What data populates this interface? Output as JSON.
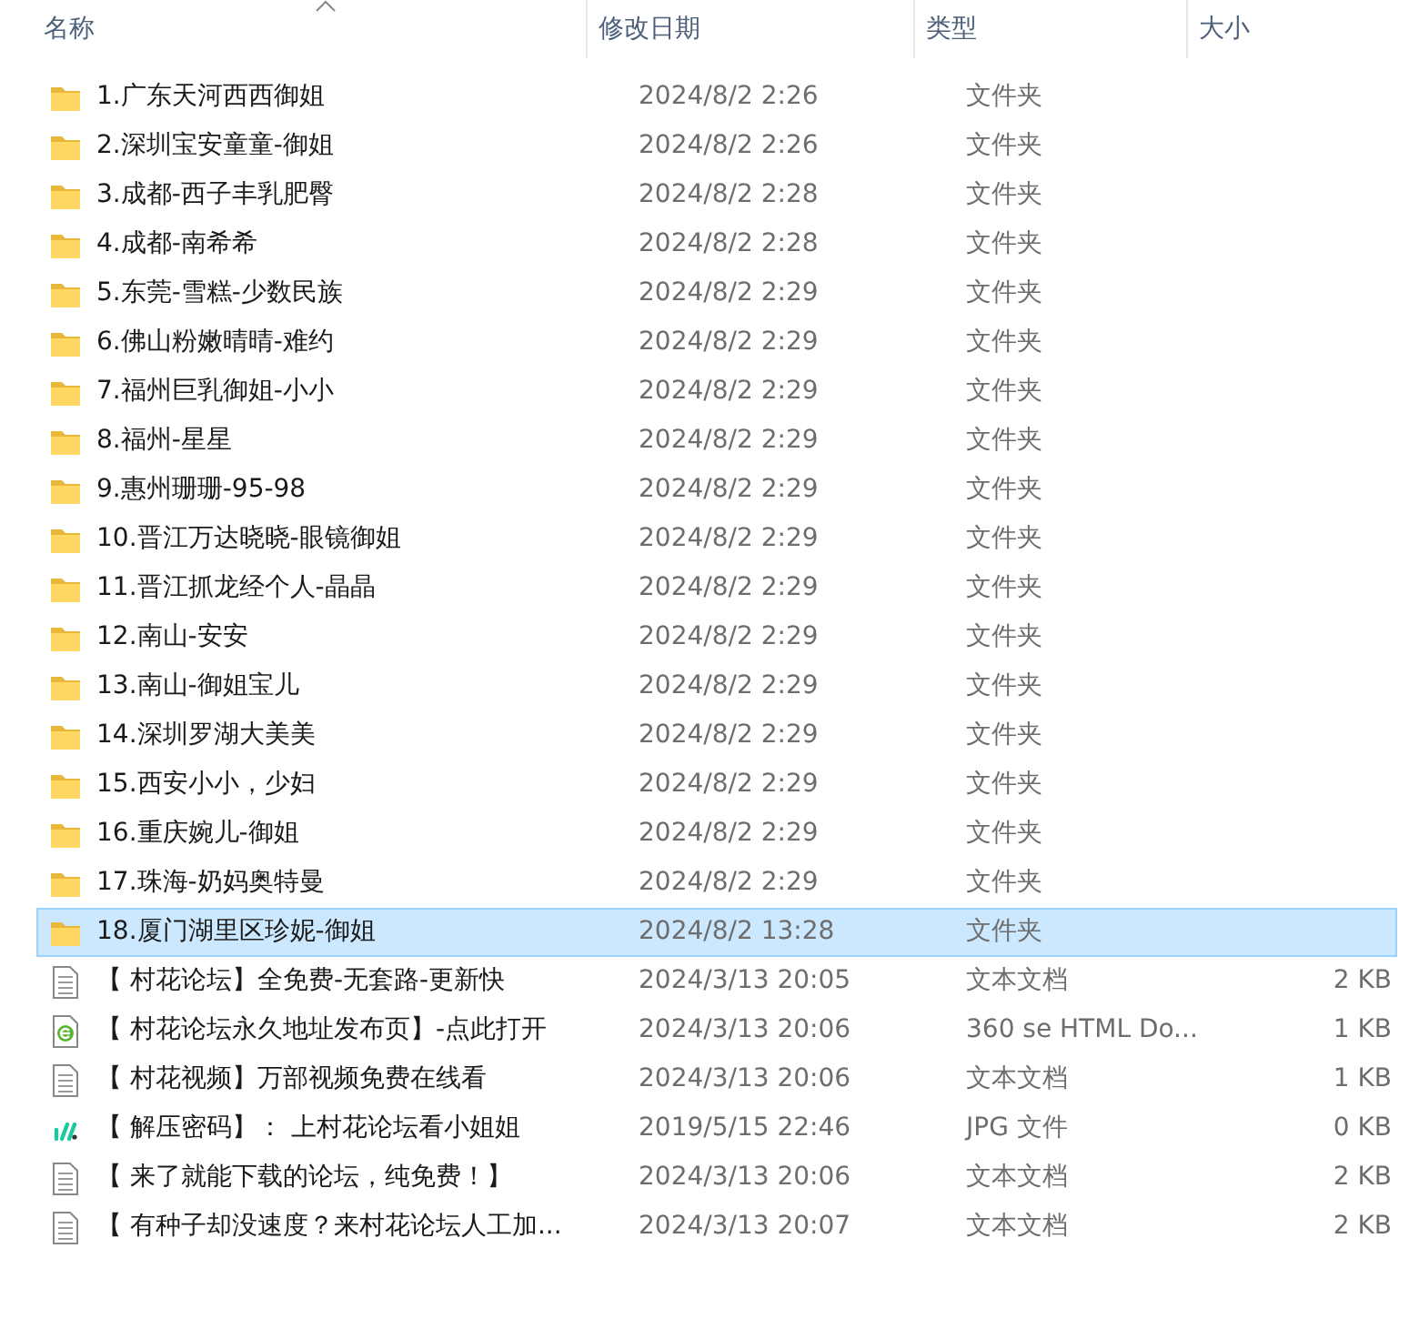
{
  "columns": [
    {
      "label": "名称",
      "sorted": true
    },
    {
      "label": "修改日期",
      "sorted": false
    },
    {
      "label": "类型",
      "sorted": false
    },
    {
      "label": "大小",
      "sorted": false
    }
  ],
  "files": [
    {
      "kind": "folder",
      "name": "1.广东天河西西御姐",
      "date": "2024/8/2 2:26",
      "type": "文件夹",
      "selected": false
    },
    {
      "kind": "folder",
      "name": "2.深圳宝安童童-御姐",
      "date": "2024/8/2 2:26",
      "type": "文件夹",
      "selected": false
    },
    {
      "kind": "folder",
      "name": "3.成都-西子丰乳肥臀",
      "date": "2024/8/2 2:28",
      "type": "文件夹",
      "selected": false
    },
    {
      "kind": "folder",
      "name": "4.成都-南希希",
      "date": "2024/8/2 2:28",
      "type": "文件夹",
      "selected": false
    },
    {
      "kind": "folder",
      "name": "5.东莞-雪糕-少数民族",
      "date": "2024/8/2 2:29",
      "type": "文件夹",
      "selected": false
    },
    {
      "kind": "folder",
      "name": "6.佛山粉嫩晴晴-难约",
      "date": "2024/8/2 2:29",
      "type": "文件夹",
      "selected": false
    },
    {
      "kind": "folder",
      "name": "7.福州巨乳御姐-小小",
      "date": "2024/8/2 2:29",
      "type": "文件夹",
      "selected": false
    },
    {
      "kind": "folder",
      "name": "8.福州-星星",
      "date": "2024/8/2 2:29",
      "type": "文件夹",
      "selected": false
    },
    {
      "kind": "folder",
      "name": "9.惠州珊珊-95-98",
      "date": "2024/8/2 2:29",
      "type": "文件夹",
      "selected": false
    },
    {
      "kind": "folder",
      "name": "10.晋江万达晓晓-眼镜御姐",
      "date": "2024/8/2 2:29",
      "type": "文件夹",
      "selected": false
    },
    {
      "kind": "folder",
      "name": "11.晋江抓龙经个人-晶晶",
      "date": "2024/8/2 2:29",
      "type": "文件夹",
      "selected": false
    },
    {
      "kind": "folder",
      "name": "12.南山-安安",
      "date": "2024/8/2 2:29",
      "type": "文件夹",
      "selected": false
    },
    {
      "kind": "folder",
      "name": "13.南山-御姐宝儿",
      "date": "2024/8/2 2:29",
      "type": "文件夹",
      "selected": false
    },
    {
      "kind": "folder",
      "name": "14.深圳罗湖大美美",
      "date": "2024/8/2 2:29",
      "type": "文件夹",
      "selected": false
    },
    {
      "kind": "folder",
      "name": "15.西安小小，少妇",
      "date": "2024/8/2 2:29",
      "type": "文件夹",
      "selected": false
    },
    {
      "kind": "folder",
      "name": "16.重庆婉儿-御姐",
      "date": "2024/8/2 2:29",
      "type": "文件夹",
      "selected": false
    },
    {
      "kind": "folder",
      "name": "17.珠海-奶妈奥特曼",
      "date": "2024/8/2 2:29",
      "type": "文件夹",
      "selected": false
    },
    {
      "kind": "folder",
      "name": "18.厦门湖里区珍妮-御姐",
      "date": "2024/8/2 13:28",
      "type": "文件夹",
      "selected": true
    },
    {
      "kind": "text",
      "name": "【 村花论坛】全免费-无套路-更新快",
      "date": "2024/3/13 20:05",
      "type": "文本文档",
      "size": "2 KB",
      "selected": false
    },
    {
      "kind": "html",
      "name": "【 村花论坛永久地址发布页】-点此打开",
      "date": "2024/3/13 20:06",
      "type": "360 se HTML Do...",
      "size": "1 KB",
      "selected": false
    },
    {
      "kind": "text",
      "name": "【 村花视频】万部视频免费在线看",
      "date": "2024/3/13 20:06",
      "type": "文本文档",
      "size": "1 KB",
      "selected": false
    },
    {
      "kind": "image",
      "name": "【 解压密码】： 上村花论坛看小姐姐",
      "date": "2019/5/15 22:46",
      "type": "JPG 文件",
      "size": "0 KB",
      "selected": false
    },
    {
      "kind": "text",
      "name": "【 来了就能下载的论坛，纯免费！】",
      "date": "2024/3/13 20:06",
      "type": "文本文档",
      "size": "2 KB",
      "selected": false
    },
    {
      "kind": "text",
      "name": "【 有种子却没速度？来村花论坛人工加...",
      "date": "2024/3/13 20:07",
      "type": "文本文档",
      "size": "2 KB",
      "selected": false
    }
  ]
}
